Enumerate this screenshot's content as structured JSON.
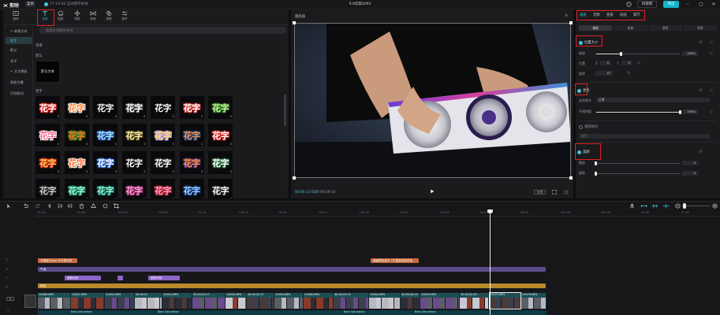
{
  "app": {
    "name": "剪映",
    "menu_label": "菜单",
    "save_status": "17:19:46 自动保存本地",
    "project_title": "9.8剪辑3093",
    "shortcut_label": "快捷键",
    "export_label": "导出",
    "accent_color": "#3ec8d8",
    "highlight_color": "#e02020"
  },
  "tool_tabs": [
    {
      "label": "媒体",
      "icon": "media-icon"
    },
    {
      "label": "文本",
      "icon": "text-icon"
    },
    {
      "label": "贴纸",
      "icon": "sticker-icon"
    },
    {
      "label": "特效",
      "icon": "effects-icon"
    },
    {
      "label": "转场",
      "icon": "transition-icon"
    },
    {
      "label": "滤镜",
      "icon": "filter-icon"
    },
    {
      "label": "调节",
      "icon": "adjust-icon"
    }
  ],
  "text_nav": [
    {
      "label": "+ 新建文本",
      "active": false
    },
    {
      "label": "花字",
      "active": true
    },
    {
      "label": "默认",
      "active": false
    },
    {
      "label": "花字",
      "active": false
    },
    {
      "label": "+ 文字模板",
      "active": false
    },
    {
      "label": "智能字幕",
      "active": false
    },
    {
      "label": "识别歌词",
      "active": false
    }
  ],
  "text_panel": {
    "search_placeholder": "搜索花字颜色/样式",
    "section_common": "常用",
    "section_default": "默认",
    "default_card_label": "默认文本",
    "section_flower": "花字",
    "flower_label": "花字"
  },
  "player": {
    "title": "播放器",
    "time_current": "00:00:13:03",
    "time_total": "00:00:09:14",
    "ratio_label": "比例"
  },
  "inspector": {
    "tabs": [
      {
        "label": "画面",
        "active": true
      },
      {
        "label": "音频",
        "active": false
      },
      {
        "label": "变速",
        "active": false
      },
      {
        "label": "动画",
        "active": false
      },
      {
        "label": "调节",
        "active": false
      }
    ],
    "sub_tabs": [
      {
        "label": "基础",
        "active": true
      },
      {
        "label": "抠像",
        "active": false
      },
      {
        "label": "蒙版",
        "active": false
      },
      {
        "label": "背景",
        "active": false
      }
    ],
    "position_section": {
      "title": "位置大小",
      "scale_label": "缩放",
      "scale_value": "100%",
      "scale_level": 0.3,
      "position_label": "位置",
      "pos_x_label": "X",
      "pos_x": "0",
      "pos_y_label": "Y",
      "pos_y": "0",
      "rotate_label": "旋转",
      "rotate_value": "0°"
    },
    "blend_section": {
      "title": "混合",
      "mode_label": "混合模式",
      "mode_value": "正常",
      "opacity_label": "不透明度",
      "opacity_value": "100%",
      "opacity_level": 1.0
    },
    "stabilize_section": {
      "title": "视频防抖",
      "level_value": "推荐"
    },
    "beauty_section": {
      "title": "美颜",
      "smooth_label": "磨皮",
      "smooth_value": "0",
      "thin_label": "瘦脸",
      "thin_value": "0"
    }
  },
  "timeline": {
    "ruler_labels": [
      "00:00",
      "00:05",
      "100:00",
      "100:05",
      "00:10",
      "100:15",
      "00:20",
      "00:25",
      "100:30",
      "00:30",
      "100:35",
      "00:40",
      "00:45",
      "100:50",
      "100:55",
      "01:00",
      "01:05"
    ],
    "text_clips": [
      {
        "label": "今晚就Game 8TS等你来",
        "start": 0,
        "end": 50
      },
      {
        "label": "超级黑色显卡 / 扩散新品发布会",
        "start": 422,
        "end": 483
      }
    ],
    "effect_clip": {
      "label": "气泡"
    },
    "fx_clips": [
      {
        "label": "金粉闪烁",
        "start": 34,
        "end": 80
      },
      {
        "label": "",
        "start": 101,
        "end": 108
      },
      {
        "label": "金粉闪烁",
        "start": 140,
        "end": 180
      }
    ],
    "sticker_clip": {
      "label": "贴纸"
    },
    "video_clips": [
      {
        "label": "C0066.MP4",
        "start": 0,
        "end": 42
      },
      {
        "label": "C0047.MP4",
        "start": 42,
        "end": 85
      },
      {
        "label": "C0050.MP4",
        "start": 85,
        "end": 123
      },
      {
        "label": "00:00:01",
        "start": 123,
        "end": 158
      },
      {
        "label": "C0051.MP4",
        "start": 158,
        "end": 196
      },
      {
        "label": "00:00:02:27",
        "start": 196,
        "end": 238
      },
      {
        "label": "C0050.MP4",
        "start": 238,
        "end": 265
      },
      {
        "label": "00:00:02:27",
        "start": 265,
        "end": 300
      },
      {
        "label": "C0055.MP4",
        "start": 300,
        "end": 337
      },
      {
        "label": "C0060.MP4",
        "start": 337,
        "end": 375
      },
      {
        "label": "00:00:03:15",
        "start": 375,
        "end": 420
      },
      {
        "label": "C0044.MP4",
        "start": 420,
        "end": 460
      },
      {
        "label": "00:00:00:14",
        "start": 460,
        "end": 485
      },
      {
        "label": "C0045.MP4",
        "start": 485,
        "end": 535
      },
      {
        "label": "00:00:02:20",
        "start": 535,
        "end": 572
      },
      {
        "label": "C0075.MP4",
        "start": 572,
        "end": 613
      },
      {
        "label": "C0076.MP4",
        "start": 613,
        "end": 645
      }
    ],
    "audio_labels": [
      "Bass Saturation",
      "Bass Saturation",
      "Bass Saturation",
      "Bass Saturation"
    ]
  }
}
